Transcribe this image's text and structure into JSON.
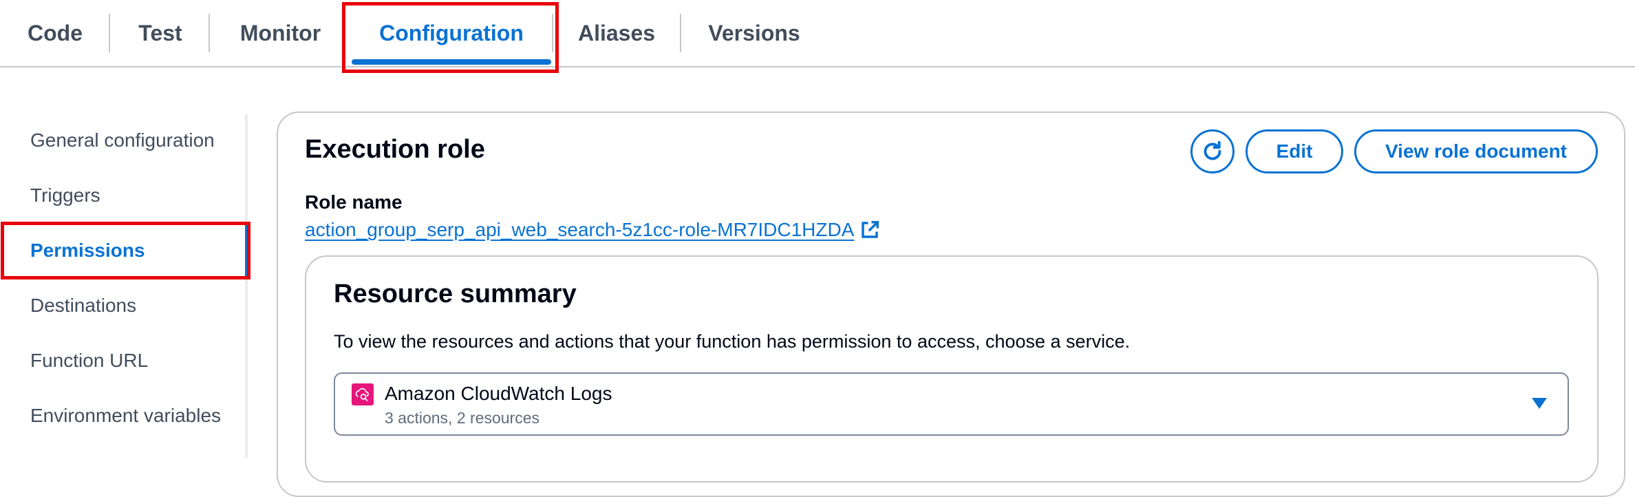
{
  "tabs": [
    {
      "label": "Code"
    },
    {
      "label": "Test"
    },
    {
      "label": "Monitor"
    },
    {
      "label": "Configuration",
      "active": true
    },
    {
      "label": "Aliases"
    },
    {
      "label": "Versions"
    }
  ],
  "side_nav": {
    "items": [
      {
        "label": "General configuration"
      },
      {
        "label": "Triggers"
      },
      {
        "label": "Permissions",
        "active": true
      },
      {
        "label": "Destinations"
      },
      {
        "label": "Function URL"
      },
      {
        "label": "Environment variables"
      }
    ]
  },
  "execution_role": {
    "title": "Execution role",
    "refresh_icon": "refresh-icon",
    "edit_label": "Edit",
    "view_role_label": "View role document",
    "role_name_label": "Role name",
    "role_name": "action_group_serp_api_web_search-5z1cc-role-MR7IDC1HZDA",
    "external_link_icon": "external-link-icon"
  },
  "resource_summary": {
    "title": "Resource summary",
    "description": "To view the resources and actions that your function has permission to access, choose a service.",
    "selected_service": {
      "name": "Amazon CloudWatch Logs",
      "detail": "3 actions, 2 resources",
      "icon": "cloudwatch-logs-icon"
    }
  },
  "colors": {
    "accent": "#0972d3",
    "highlight": "#e8000b",
    "service_icon": "#e7157b"
  }
}
